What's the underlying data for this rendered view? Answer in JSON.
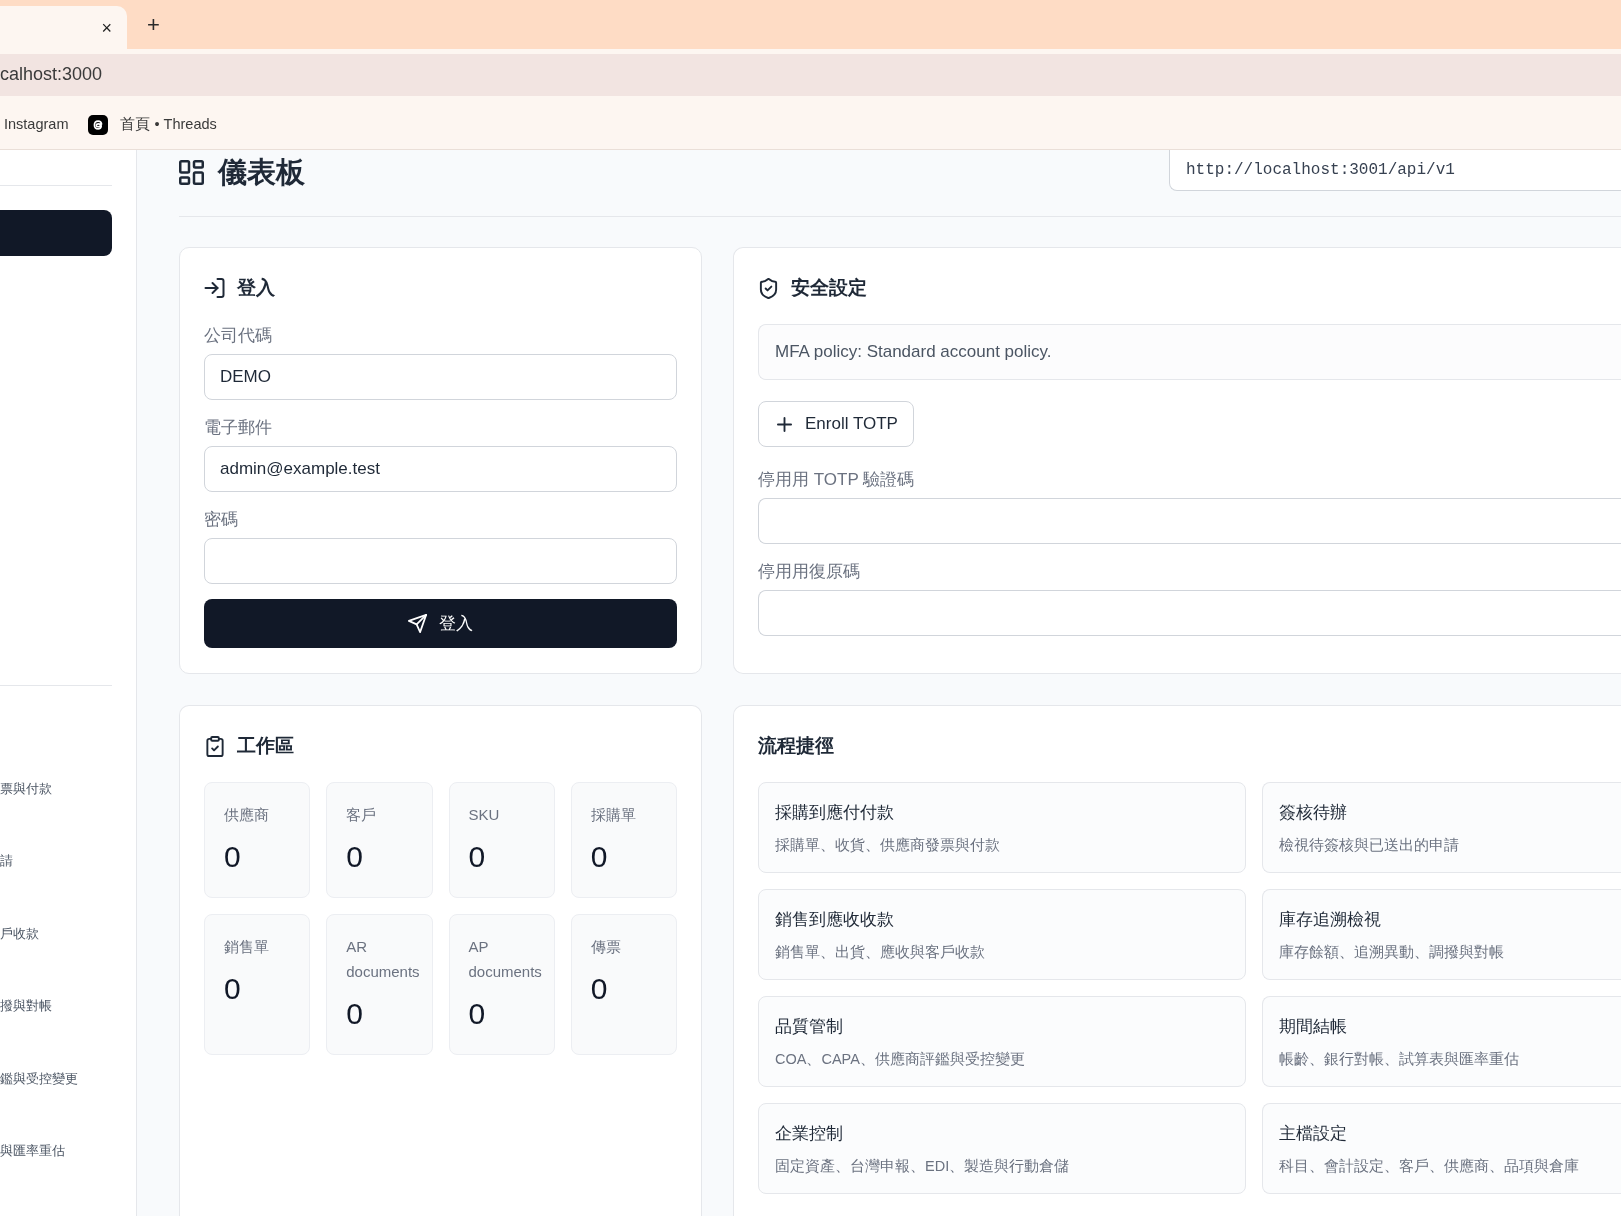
{
  "browser": {
    "tabs": [
      {
        "selected": true,
        "close": "×"
      }
    ],
    "new_tab": "+",
    "address": "calhost:3000",
    "bookmarks": [
      {
        "label": "Instagram",
        "kind": "plain"
      },
      {
        "label": "首頁 • Threads",
        "kind": "icon"
      }
    ]
  },
  "sidebar": {
    "nav_items": [
      {
        "selected": true
      }
    ],
    "links": [
      "票與付款",
      "請",
      "戶收款",
      "撥與對帳",
      "鑑與受控變更",
      "與匯率重估"
    ]
  },
  "header": {
    "title": "儀表板",
    "api_base": {
      "value": "http://localhost:3001/api/v1"
    }
  },
  "login": {
    "title": "登入",
    "fields": [
      {
        "label": "公司代碼",
        "value": "DEMO"
      },
      {
        "label": "電子郵件",
        "value": "admin@example.test"
      },
      {
        "label": "密碼"
      }
    ],
    "submit": "登入"
  },
  "security": {
    "title": "安全設定",
    "policy": "MFA policy: Standard account policy.",
    "enroll_button": "Enroll TOTP",
    "fields": [
      {
        "label": "停用用 TOTP 驗證碼"
      },
      {
        "label": "停用用復原碼"
      }
    ]
  },
  "workspace": {
    "title": "工作區",
    "stats": [
      {
        "label": "供應商",
        "value": "0"
      },
      {
        "label": "客戶",
        "value": "0"
      },
      {
        "label": "SKU",
        "value": "0"
      },
      {
        "label": "採購單",
        "value": "0"
      },
      {
        "label": "銷售單",
        "value": "0"
      },
      {
        "label": "AR documents",
        "value": "0"
      },
      {
        "label": "AP documents",
        "value": "0"
      },
      {
        "label": "傳票",
        "value": "0"
      }
    ]
  },
  "shortcuts": {
    "title": "流程捷徑",
    "items": [
      {
        "title": "採購到應付付款",
        "description": "採購單、收貨、供應商發票與付款"
      },
      {
        "title": "簽核待辦",
        "description": "檢視待簽核與已送出的申請"
      },
      {
        "title": "銷售到應收收款",
        "description": "銷售單、出貨、應收與客戶收款"
      },
      {
        "title": "庫存追溯檢視",
        "description": "庫存餘額、追溯異動、調撥與對帳"
      },
      {
        "title": "品質管制",
        "description": "COA、CAPA、供應商評鑑與受控變更"
      },
      {
        "title": "期間結帳",
        "description": "帳齡、銀行對帳、試算表與匯率重估"
      },
      {
        "title": "企業控制",
        "description": "固定資產、台灣申報、EDI、製造與行動倉儲"
      },
      {
        "title": "主檔設定",
        "description": "科目、會計設定、客戶、供應商、品項與倉庫"
      }
    ]
  }
}
